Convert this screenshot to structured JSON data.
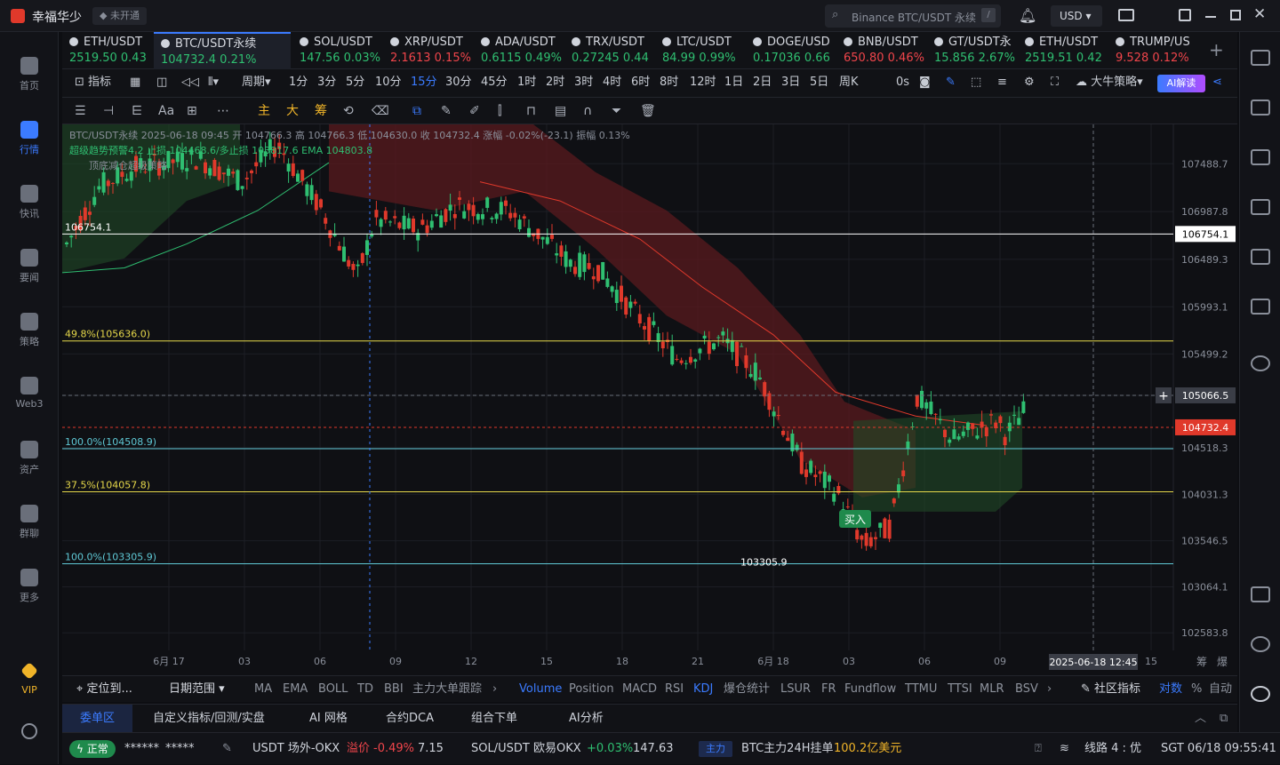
{
  "app": {
    "name": "幸福华少",
    "badge": "未开通",
    "currency": "USD",
    "search_placeholder": "Binance BTC/USDT 永续",
    "search_shortcut": "/"
  },
  "sidebar": [
    {
      "label": "首页"
    },
    {
      "label": "行情",
      "active": true
    },
    {
      "label": "快讯"
    },
    {
      "label": "要闻"
    },
    {
      "label": "策略"
    },
    {
      "label": "Web3"
    },
    {
      "label": "资产"
    },
    {
      "label": "群聊"
    },
    {
      "label": "更多"
    },
    {
      "label": "VIP"
    }
  ],
  "tickers": [
    {
      "name": "ETH/USDT",
      "price": "2519.50",
      "change": "0.43",
      "dir": "up"
    },
    {
      "name": "BTC/USDT永续",
      "price": "104732.4",
      "change": "0.21%",
      "dir": "up",
      "active": true
    },
    {
      "name": "SOL/USDT",
      "price": "147.56",
      "change": "0.03%",
      "dir": "up"
    },
    {
      "name": "XRP/USDT",
      "price": "2.1613",
      "change": "0.15%",
      "dir": "down"
    },
    {
      "name": "ADA/USDT",
      "price": "0.6115",
      "change": "0.49%",
      "dir": "up"
    },
    {
      "name": "TRX/USDT",
      "price": "0.27245",
      "change": "0.44",
      "dir": "up"
    },
    {
      "name": "LTC/USDT",
      "price": "84.99",
      "change": "0.99%",
      "dir": "up"
    },
    {
      "name": "DOGE/USD",
      "price": "0.17036",
      "change": "0.66",
      "dir": "up"
    },
    {
      "name": "BNB/USDT",
      "price": "650.80",
      "change": "0.46%",
      "dir": "down"
    },
    {
      "name": "GT/USDT永",
      "price": "15.856",
      "change": "2.67%",
      "dir": "up"
    },
    {
      "name": "ETH/USDT",
      "price": "2519.51",
      "change": "0.42",
      "dir": "up"
    },
    {
      "name": "TRUMP/US",
      "price": "9.528",
      "change": "0.12%",
      "dir": "down"
    }
  ],
  "toolbar": {
    "indicator": "指标",
    "period": "周期",
    "intervals": [
      "1分",
      "3分",
      "5分",
      "10分",
      "15分",
      "30分",
      "45分",
      "1时",
      "2时",
      "3时",
      "4时",
      "6时",
      "8时",
      "12时",
      "1日",
      "2日",
      "3日",
      "5日",
      "周K"
    ],
    "selected_interval": "15分",
    "zero_s": "0s",
    "strategy": "大牛策略",
    "ai": "AI解读"
  },
  "drawbar": {
    "main": "主",
    "big": "大",
    "chip": "筹",
    "text": "Aa"
  },
  "chart_info": {
    "line1": "BTC/USDT永续  2025-06-18 09:45  开 104766.3  高 104766.3  低 104630.0  收 104732.4  涨幅 -0.02%(-23.1)  振幅 0.13%",
    "line2": "超级趋势预警4.2  止损 104468.6/多止损 103817.6  EMA 104803.8",
    "line3": "顶底减仓超级策略"
  },
  "chart_data": {
    "type": "candlestick",
    "y_ticks": [
      107488.7,
      106987.8,
      106489.3,
      105993.1,
      105499.2,
      105066.5,
      104518.3,
      104031.3,
      103546.5,
      103064.1,
      102583.8
    ],
    "x_ticks": [
      "6月 17",
      "03",
      "06",
      "09",
      "12",
      "15",
      "18",
      "21",
      "6月 18",
      "03",
      "06",
      "09",
      "15"
    ],
    "x_cursor_label": "2025-06-18 12:45",
    "levels": [
      {
        "label": "106754.1",
        "value": 106754.1,
        "color": "#ffffff"
      },
      {
        "label": "49.8%(105636.0)",
        "value": 105636.0,
        "color": "#e6d84a"
      },
      {
        "label": "100.0%(104508.9)",
        "value": 104508.9,
        "color": "#5fc9d6"
      },
      {
        "label": "37.5%(104057.8)",
        "value": 104057.8,
        "color": "#e6d84a"
      },
      {
        "label": "100.0%(103305.9)",
        "value": 103305.9,
        "color": "#5fc9d6"
      }
    ],
    "price_tags": {
      "white": "106754.1",
      "cursor": "105066.5",
      "last": "104732.4"
    },
    "low_label": "103305.9",
    "buy_label": "买入",
    "ylim": [
      102400,
      107900
    ]
  },
  "bottombar": {
    "locate": "定位到...",
    "range": "日期范围",
    "indicators": [
      "MA",
      "EMA",
      "BOLL",
      "TD",
      "BBI",
      "主力大单跟踪"
    ],
    "sub_indicators": [
      "Volume",
      "Position",
      "MACD",
      "RSI",
      "KDJ",
      "爆仓统计",
      "LSUR",
      "FR",
      "Fundflow",
      "TTMU",
      "TTSI",
      "MLR",
      "BSV"
    ],
    "selected": [
      "Volume",
      "KDJ"
    ],
    "community": "社区指标",
    "log": "对数",
    "pct": "%",
    "auto": "自动"
  },
  "panels": [
    "委单区",
    "自定义指标/回测/实盘",
    "AI 网格",
    "合约DCA",
    "组合下单",
    "AI分析"
  ],
  "statusbar": {
    "status": "正常",
    "masked1": "******",
    "masked2": "*****",
    "usdt_label": "USDT 场外-OKX",
    "premium_label": "溢价",
    "premium": "-0.49%",
    "usdt_price": "7.15",
    "sol_label": "SOL/USDT 欧易OKX",
    "sol_change": "+0.03%",
    "sol_price": "147.63",
    "main_tag": "主力",
    "btc_main": "BTC主力24H挂单",
    "btc_amount": "100.2亿美元",
    "line": "线路 4 : 优",
    "time": "SGT 06/18 09:55:41"
  }
}
